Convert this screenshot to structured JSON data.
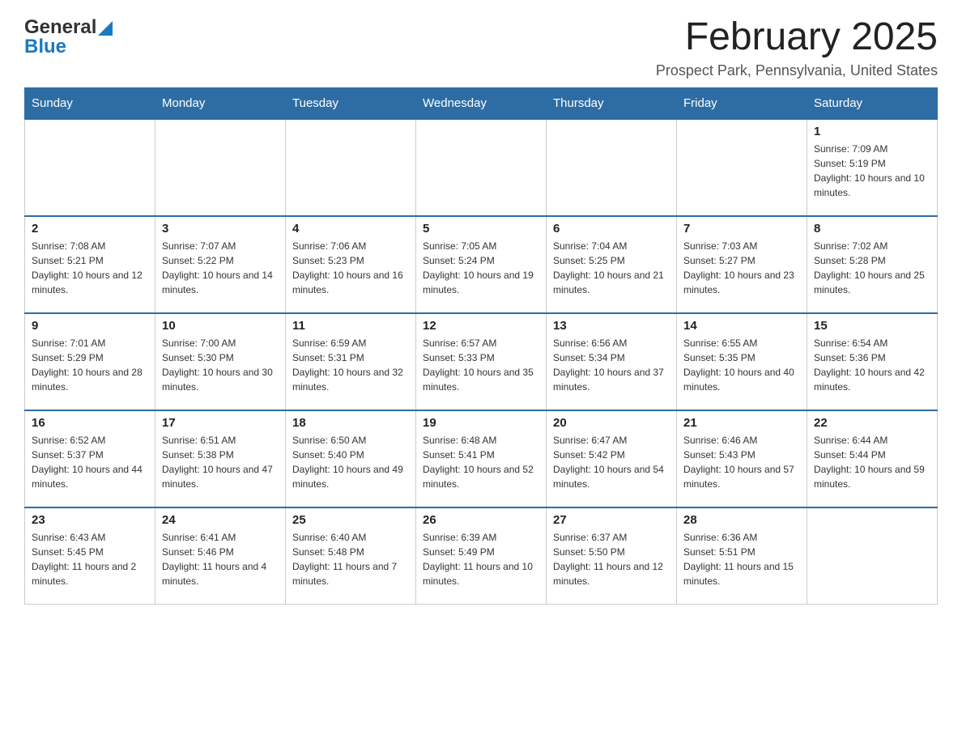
{
  "header": {
    "logo_general": "General",
    "logo_blue": "Blue",
    "month_title": "February 2025",
    "location": "Prospect Park, Pennsylvania, United States"
  },
  "weekdays": [
    "Sunday",
    "Monday",
    "Tuesday",
    "Wednesday",
    "Thursday",
    "Friday",
    "Saturday"
  ],
  "weeks": [
    [
      {
        "day": "",
        "info": ""
      },
      {
        "day": "",
        "info": ""
      },
      {
        "day": "",
        "info": ""
      },
      {
        "day": "",
        "info": ""
      },
      {
        "day": "",
        "info": ""
      },
      {
        "day": "",
        "info": ""
      },
      {
        "day": "1",
        "info": "Sunrise: 7:09 AM\nSunset: 5:19 PM\nDaylight: 10 hours and 10 minutes."
      }
    ],
    [
      {
        "day": "2",
        "info": "Sunrise: 7:08 AM\nSunset: 5:21 PM\nDaylight: 10 hours and 12 minutes."
      },
      {
        "day": "3",
        "info": "Sunrise: 7:07 AM\nSunset: 5:22 PM\nDaylight: 10 hours and 14 minutes."
      },
      {
        "day": "4",
        "info": "Sunrise: 7:06 AM\nSunset: 5:23 PM\nDaylight: 10 hours and 16 minutes."
      },
      {
        "day": "5",
        "info": "Sunrise: 7:05 AM\nSunset: 5:24 PM\nDaylight: 10 hours and 19 minutes."
      },
      {
        "day": "6",
        "info": "Sunrise: 7:04 AM\nSunset: 5:25 PM\nDaylight: 10 hours and 21 minutes."
      },
      {
        "day": "7",
        "info": "Sunrise: 7:03 AM\nSunset: 5:27 PM\nDaylight: 10 hours and 23 minutes."
      },
      {
        "day": "8",
        "info": "Sunrise: 7:02 AM\nSunset: 5:28 PM\nDaylight: 10 hours and 25 minutes."
      }
    ],
    [
      {
        "day": "9",
        "info": "Sunrise: 7:01 AM\nSunset: 5:29 PM\nDaylight: 10 hours and 28 minutes."
      },
      {
        "day": "10",
        "info": "Sunrise: 7:00 AM\nSunset: 5:30 PM\nDaylight: 10 hours and 30 minutes."
      },
      {
        "day": "11",
        "info": "Sunrise: 6:59 AM\nSunset: 5:31 PM\nDaylight: 10 hours and 32 minutes."
      },
      {
        "day": "12",
        "info": "Sunrise: 6:57 AM\nSunset: 5:33 PM\nDaylight: 10 hours and 35 minutes."
      },
      {
        "day": "13",
        "info": "Sunrise: 6:56 AM\nSunset: 5:34 PM\nDaylight: 10 hours and 37 minutes."
      },
      {
        "day": "14",
        "info": "Sunrise: 6:55 AM\nSunset: 5:35 PM\nDaylight: 10 hours and 40 minutes."
      },
      {
        "day": "15",
        "info": "Sunrise: 6:54 AM\nSunset: 5:36 PM\nDaylight: 10 hours and 42 minutes."
      }
    ],
    [
      {
        "day": "16",
        "info": "Sunrise: 6:52 AM\nSunset: 5:37 PM\nDaylight: 10 hours and 44 minutes."
      },
      {
        "day": "17",
        "info": "Sunrise: 6:51 AM\nSunset: 5:38 PM\nDaylight: 10 hours and 47 minutes."
      },
      {
        "day": "18",
        "info": "Sunrise: 6:50 AM\nSunset: 5:40 PM\nDaylight: 10 hours and 49 minutes."
      },
      {
        "day": "19",
        "info": "Sunrise: 6:48 AM\nSunset: 5:41 PM\nDaylight: 10 hours and 52 minutes."
      },
      {
        "day": "20",
        "info": "Sunrise: 6:47 AM\nSunset: 5:42 PM\nDaylight: 10 hours and 54 minutes."
      },
      {
        "day": "21",
        "info": "Sunrise: 6:46 AM\nSunset: 5:43 PM\nDaylight: 10 hours and 57 minutes."
      },
      {
        "day": "22",
        "info": "Sunrise: 6:44 AM\nSunset: 5:44 PM\nDaylight: 10 hours and 59 minutes."
      }
    ],
    [
      {
        "day": "23",
        "info": "Sunrise: 6:43 AM\nSunset: 5:45 PM\nDaylight: 11 hours and 2 minutes."
      },
      {
        "day": "24",
        "info": "Sunrise: 6:41 AM\nSunset: 5:46 PM\nDaylight: 11 hours and 4 minutes."
      },
      {
        "day": "25",
        "info": "Sunrise: 6:40 AM\nSunset: 5:48 PM\nDaylight: 11 hours and 7 minutes."
      },
      {
        "day": "26",
        "info": "Sunrise: 6:39 AM\nSunset: 5:49 PM\nDaylight: 11 hours and 10 minutes."
      },
      {
        "day": "27",
        "info": "Sunrise: 6:37 AM\nSunset: 5:50 PM\nDaylight: 11 hours and 12 minutes."
      },
      {
        "day": "28",
        "info": "Sunrise: 6:36 AM\nSunset: 5:51 PM\nDaylight: 11 hours and 15 minutes."
      },
      {
        "day": "",
        "info": ""
      }
    ]
  ]
}
